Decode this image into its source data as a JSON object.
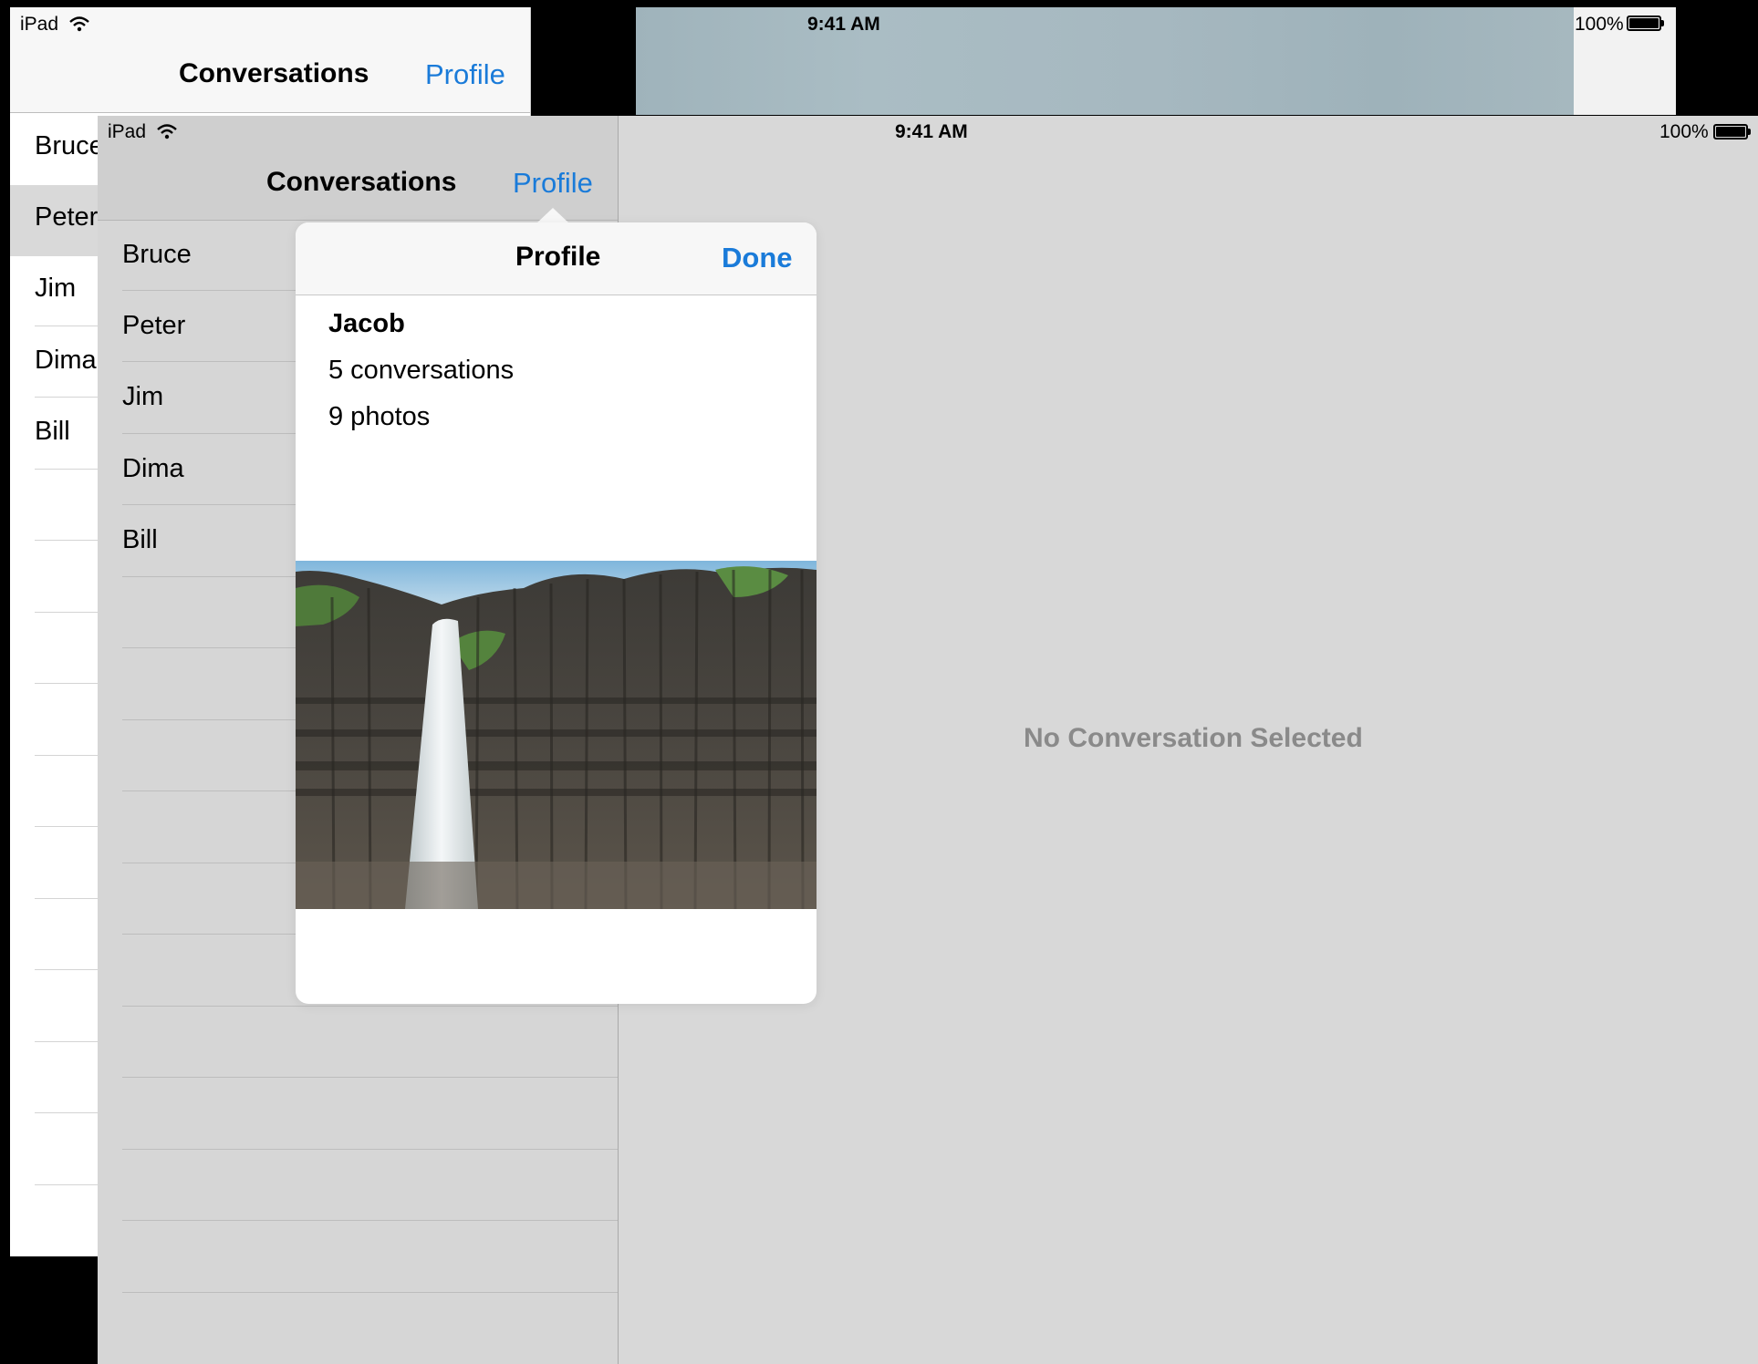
{
  "back_screen": {
    "status_bar": {
      "device": "iPad",
      "time": "9:41 AM",
      "battery": "100%"
    },
    "nav_bar": {
      "title": "Conversations",
      "profile_link": "Profile"
    },
    "conversations": [
      "Bruce",
      "Peter",
      "Jim",
      "Dima",
      "Bill"
    ],
    "selected_index": 1
  },
  "front_screen": {
    "status_bar": {
      "device": "iPad",
      "time": "9:41 AM",
      "battery": "100%"
    },
    "nav_bar": {
      "title": "Conversations",
      "profile_link": "Profile"
    },
    "conversations": [
      "Bruce",
      "Peter",
      "Jim",
      "Dima",
      "Bill"
    ],
    "detail": {
      "empty_message": "No Conversation Selected"
    },
    "popover": {
      "title": "Profile",
      "done_label": "Done",
      "name": "Jacob",
      "conversations_count": "5 conversations",
      "photos_count": "9 photos",
      "photo": "waterfall over basalt columns"
    }
  },
  "colors": {
    "tint": "#1a7bd9",
    "dimmed_background": "#d8d8d8",
    "empty_text": "#8a8a8a"
  }
}
